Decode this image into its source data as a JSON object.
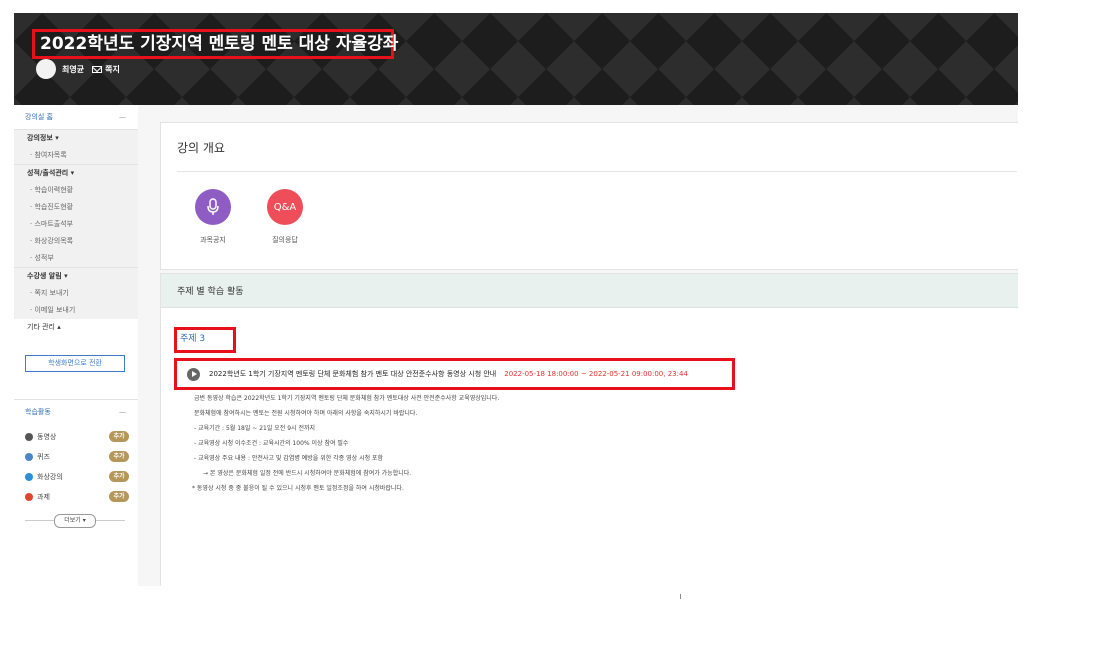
{
  "header": {
    "course_title": "2022학년도 기장지역 멘토링 멘토 대상 자율강좌",
    "user_name": "최영균",
    "message_label": "쪽지"
  },
  "sidebar": {
    "classroom_home": "강의실 홈",
    "collapse_symbol": "—",
    "groups": [
      {
        "label": "강의정보 ▾",
        "items": [
          "· 참여자목록"
        ]
      },
      {
        "label": "성적/출석관리 ▾",
        "items": [
          "· 학습이력현황",
          "· 학습진도현황",
          "· 스마트출석부",
          "· 화상강의목록",
          "· 성적부"
        ]
      },
      {
        "label": "수강생 알림 ▾",
        "items": [
          "· 쪽지 보내기",
          "· 이메일 보내기"
        ]
      }
    ],
    "other_manage": "기타 관리 ▴",
    "learner_view_button": "학생화면으로 전환",
    "activity_title": "학습활동",
    "activities": [
      {
        "label": "동영상",
        "badge": "추가",
        "color": "#555555"
      },
      {
        "label": "퀴즈",
        "badge": "추가",
        "color": "#4a86c8"
      },
      {
        "label": "화상강의",
        "badge": "추가",
        "color": "#2b8fd6"
      },
      {
        "label": "과제",
        "badge": "추가",
        "color": "#e0462b"
      }
    ],
    "more_button": "더보기 ▾"
  },
  "overview": {
    "title": "강의 개요",
    "items": [
      {
        "label": "과목공지",
        "icon": "microphone-icon",
        "color": "#8f5cc4"
      },
      {
        "label": "질의응답",
        "circle_text": "Q&A",
        "icon": "qa-icon",
        "color": "#ee4e5a"
      }
    ]
  },
  "topics": {
    "title": "주제 별 학습 활동",
    "topic_name": "주제 3",
    "video_title": "2022학년도 1학기 기장지역 멘토링 단체 문화체험 참가 멘토 대상 안전준수사항 동영상 시청 안내",
    "video_period": "2022-05-18 18:00:00 ~ 2022-05-21 09:00:00, 23:44",
    "description": [
      "금번 동영상 학습은 2022학년도 1학기 기장지역 멘토링 단체 문화체험 참가 멘토대상 사전 안전준수사항 교육영상입니다.",
      "문화체험에 참여하시는 멘토는 전원 시청하여야 하며 아래의 사항을 숙지하시기 바랍니다.",
      "- 교육기간 : 5월 18일 ~ 21일 오전 9시 전까지",
      "- 교육영상 시청 이수조건 : 교육시간의 100% 이상 참여 필수",
      "- 교육영상 주요 내용 : 안전사고 및 감염병 예방을 위한 각종 영상 시청 포함",
      "→ 본 영상은 문화체험 일정 전에 반드시 시청하여야 문화체험에 참여가 가능합니다.",
      "* 동영상 시청 중 중 불응이 될 수 있으니 시청후 멘토 일정조정을 하여 시청바랍니다."
    ]
  }
}
